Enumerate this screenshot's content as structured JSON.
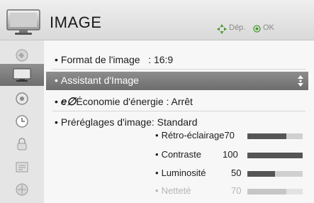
{
  "header": {
    "title": "IMAGE",
    "move_hint": "Dép.",
    "ok_hint": "OK"
  },
  "sidebar": {
    "items": [
      {
        "icon": "image-settings-icon",
        "active": false
      },
      {
        "icon": "tv-picture-icon",
        "active": true
      },
      {
        "icon": "speaker-icon",
        "active": false
      },
      {
        "icon": "clock-icon",
        "active": false
      },
      {
        "icon": "lock-icon",
        "active": false
      },
      {
        "icon": "options-icon",
        "active": false
      },
      {
        "icon": "network-icon",
        "active": false
      }
    ]
  },
  "menu": {
    "format": {
      "label": "Format de l'image",
      "value": ": 16:9"
    },
    "assistant": {
      "label": "Assistant d'Image"
    },
    "energy": {
      "logo": "e∅",
      "label": "Économie d'énergie : Arrêt"
    },
    "presets": {
      "label": "Préréglages d'image",
      "value": ": Standard"
    },
    "settings": [
      {
        "label": "Rétro-éclairage",
        "value": 70,
        "dim": false
      },
      {
        "label": "Contraste",
        "value": 100,
        "dim": false
      },
      {
        "label": "Luminosité",
        "value": 50,
        "dim": false
      },
      {
        "label": "Netteté",
        "value": 70,
        "dim": true
      }
    ]
  },
  "colors": {
    "selection": "#7d7d7d",
    "bar_fill": "#555555",
    "bar_track": "#d0d0d0"
  }
}
